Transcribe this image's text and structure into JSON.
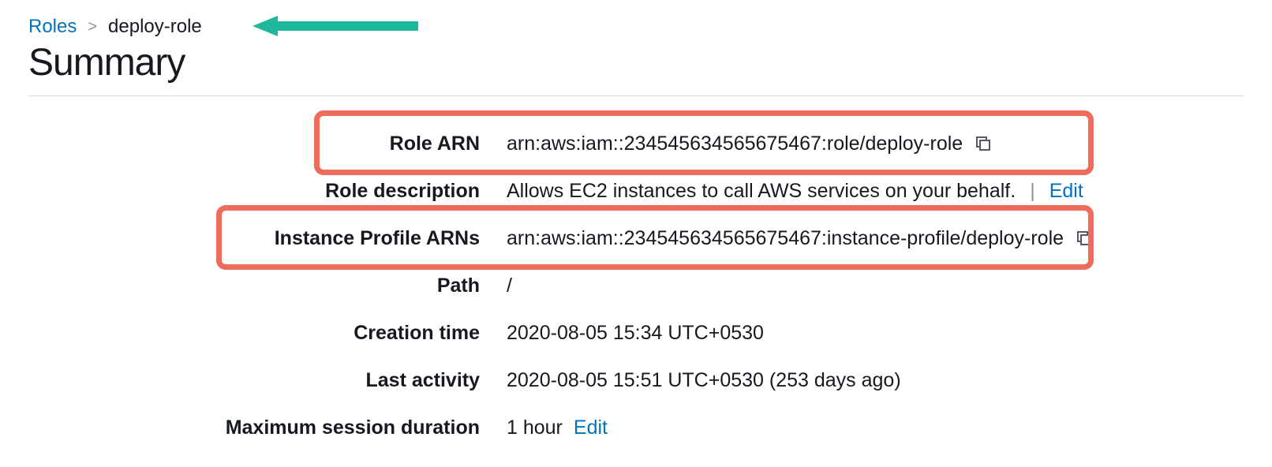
{
  "breadcrumbs": {
    "root": "Roles",
    "current": "deploy-role"
  },
  "page_title": "Summary",
  "rows": {
    "role_arn": {
      "label": "Role ARN",
      "value": "arn:aws:iam::234545634565675467:role/deploy-role"
    },
    "role_desc": {
      "label": "Role description",
      "value": "Allows EC2 instances to call AWS services on your behalf.",
      "edit": "Edit"
    },
    "instance_profile": {
      "label": "Instance Profile ARNs",
      "value": "arn:aws:iam::234545634565675467:instance-profile/deploy-role"
    },
    "path": {
      "label": "Path",
      "value": "/"
    },
    "creation_time": {
      "label": "Creation time",
      "value": "2020-08-05 15:34 UTC+0530"
    },
    "last_activity": {
      "label": "Last activity",
      "value": "2020-08-05 15:51 UTC+0530 (253 days ago)"
    },
    "max_session": {
      "label": "Maximum session duration",
      "value": "1 hour",
      "edit": "Edit"
    }
  }
}
